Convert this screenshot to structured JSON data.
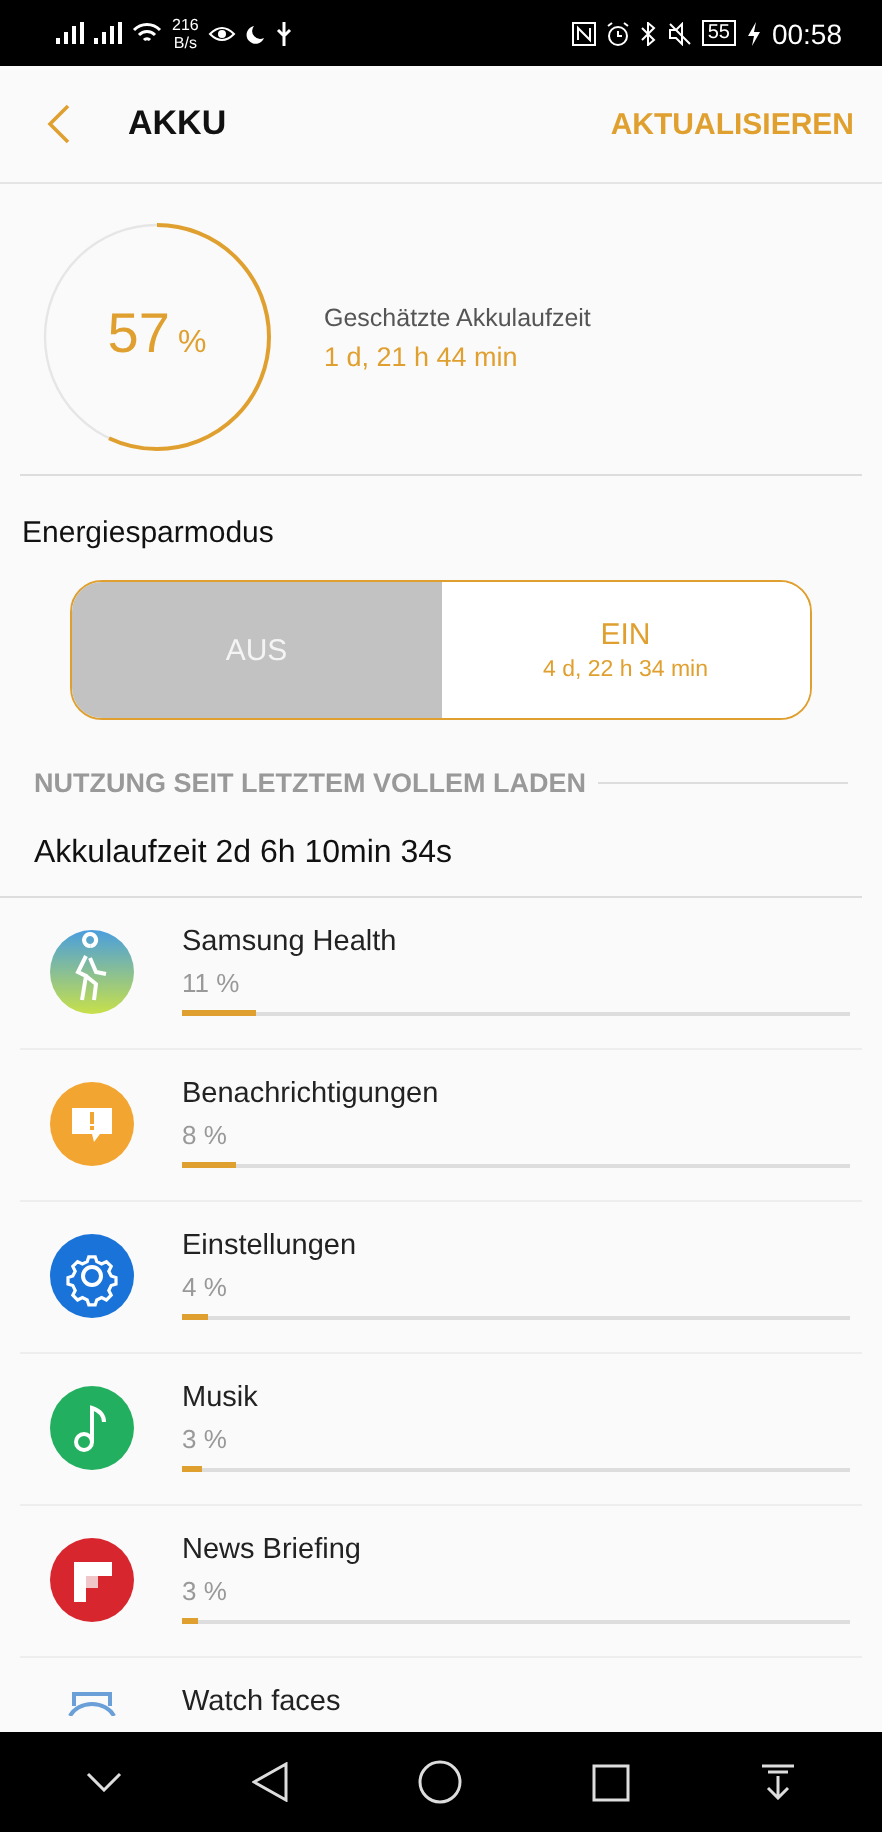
{
  "status_bar": {
    "net_speed": "216",
    "net_unit": "B/s",
    "battery": "55",
    "time": "00:58"
  },
  "header": {
    "title": "AKKU",
    "action": "AKTUALISIEREN"
  },
  "battery": {
    "percent": "57",
    "unit": "%",
    "level": 0.57,
    "estimate_label": "Geschätzte Akkulaufzeit",
    "estimate": "1 d, 21 h 44 min"
  },
  "power_saving": {
    "title": "Energiesparmodus",
    "options": [
      {
        "label": "AUS",
        "selected": true
      },
      {
        "label": "EIN",
        "sub": "4 d, 22 h 34 min",
        "selected": false
      }
    ]
  },
  "usage": {
    "heading": "NUTZUNG SEIT LETZTEM VOLLEM LADEN",
    "runtime": "Akkulaufzeit 2d 6h 10min 34s",
    "apps": [
      {
        "name": "Samsung Health",
        "percent": "11 %",
        "level": 0.11,
        "kind": "health"
      },
      {
        "name": "Benachrichtigungen",
        "percent": "8 %",
        "level": 0.08,
        "kind": "notification"
      },
      {
        "name": "Einstellungen",
        "percent": "4 %",
        "level": 0.04,
        "kind": "settings"
      },
      {
        "name": "Musik",
        "percent": "3 %",
        "level": 0.03,
        "kind": "music"
      },
      {
        "name": "News Briefing",
        "percent": "3 %",
        "level": 0.025,
        "kind": "news"
      },
      {
        "name": "Watch faces",
        "kind": "watch"
      }
    ]
  }
}
